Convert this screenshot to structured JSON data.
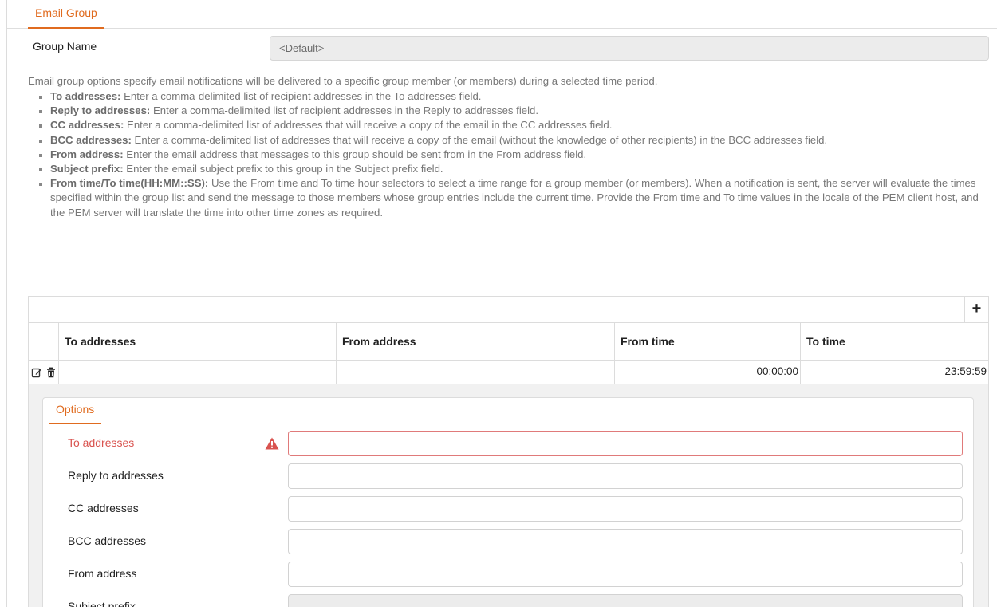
{
  "tabs": {
    "email_group": "Email Group",
    "options": "Options"
  },
  "group_name": {
    "label": "Group Name",
    "value": "<Default>"
  },
  "description": {
    "intro": "Email group options specify email notifications will be delivered to a specific group member (or members) during a selected time period.",
    "items": [
      {
        "term": "To addresses:",
        "text": " Enter a comma-delimited list of recipient addresses in the To addresses field."
      },
      {
        "term": "Reply to addresses:",
        "text": " Enter a comma-delimited list of recipient addresses in the Reply to addresses field."
      },
      {
        "term": "CC addresses:",
        "text": " Enter a comma-delimited list of addresses that will receive a copy of the email in the CC addresses field."
      },
      {
        "term": "BCC addresses:",
        "text": " Enter a comma-delimited list of addresses that will receive a copy of the email (without the knowledge of other recipients) in the BCC addresses field."
      },
      {
        "term": "From address:",
        "text": " Enter the email address that messages to this group should be sent from in the From address field."
      },
      {
        "term": "Subject prefix:",
        "text": " Enter the email subject prefix to this group in the Subject prefix field."
      },
      {
        "term": "From time/To time(HH:MM::SS):",
        "text": " Use the From time and To time hour selectors to select a time range for a group member (or members). When a notification is sent, the server will evaluate the times specified within the group list and send the message to those members whose group entries include the current time. Provide the From time and To time values in the locale of the PEM client host, and the PEM server will translate the time into other time zones as required."
      }
    ]
  },
  "grid": {
    "add_label": "+",
    "columns": [
      "To addresses",
      "From address",
      "From time",
      "To time"
    ],
    "row": {
      "to_addresses": "",
      "from_address": "",
      "from_time": "00:00:00",
      "to_time": "23:59:59"
    }
  },
  "options_form": {
    "to_addresses": "To addresses",
    "reply_to": "Reply to addresses",
    "cc": "CC addresses",
    "bcc": "BCC addresses",
    "from": "From address",
    "subject_prefix": "Subject prefix"
  },
  "colors": {
    "accent": "#e06b1f",
    "error": "#d9534f"
  },
  "icons": [
    "edit-icon",
    "trash-icon",
    "warning-icon",
    "plus-icon"
  ]
}
